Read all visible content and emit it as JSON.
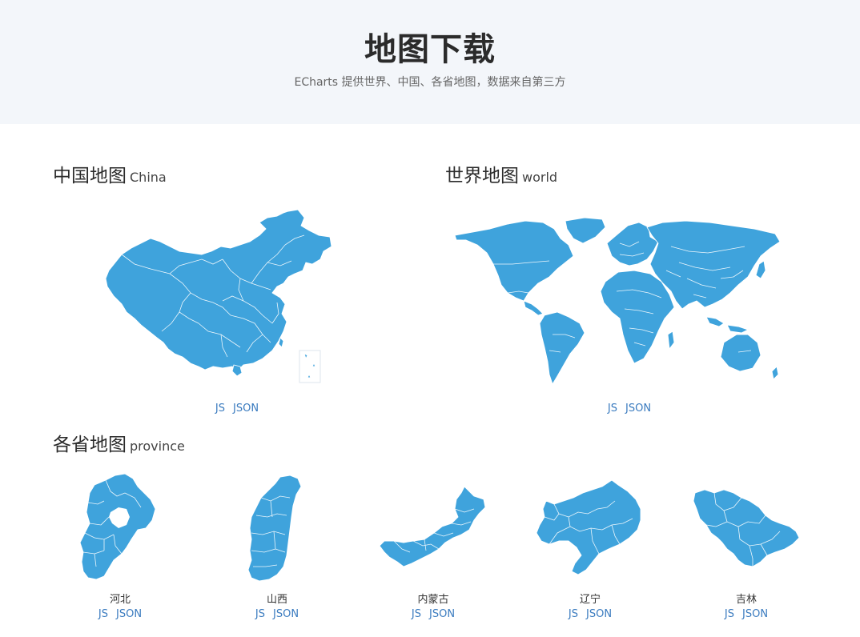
{
  "header": {
    "title": "地图下载",
    "subtitle": "ECharts 提供世界、中国、各省地图，数据来自第三方"
  },
  "china": {
    "title": "中国地图",
    "title_en": "China",
    "js": "JS",
    "json": "JSON"
  },
  "world": {
    "title": "世界地图",
    "title_en": "world",
    "js": "JS",
    "json": "JSON"
  },
  "province": {
    "title": "各省地图",
    "title_en": "province",
    "items": [
      {
        "name": "河北",
        "js": "JS",
        "json": "JSON"
      },
      {
        "name": "山西",
        "js": "JS",
        "json": "JSON"
      },
      {
        "name": "内蒙古",
        "js": "JS",
        "json": "JSON"
      },
      {
        "name": "辽宁",
        "js": "JS",
        "json": "JSON"
      },
      {
        "name": "吉林",
        "js": "JS",
        "json": "JSON"
      }
    ]
  },
  "colors": {
    "map_fill": "#3fa3dc",
    "link": "#3a7bbf",
    "hero_bg": "#f3f6fa"
  }
}
